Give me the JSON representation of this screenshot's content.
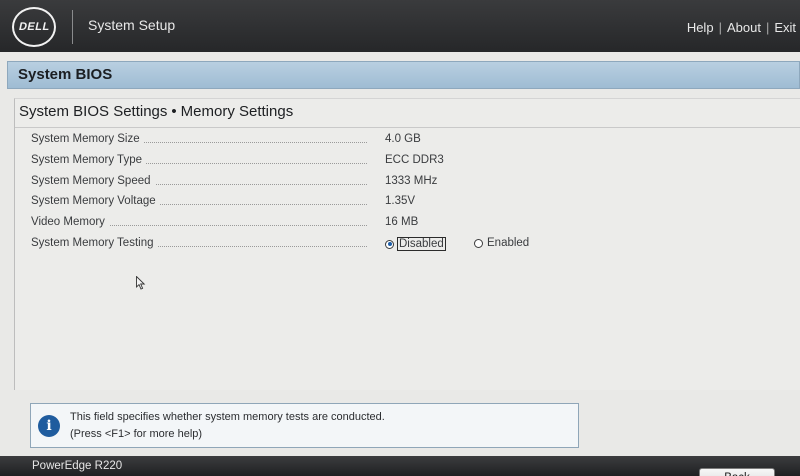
{
  "header": {
    "logo_text": "DELL",
    "app_title": "System Setup",
    "links": [
      "Help",
      "About",
      "Exit"
    ],
    "separator": "|"
  },
  "panel": {
    "title": "System BIOS"
  },
  "breadcrumb": {
    "parent": "System BIOS Settings",
    "separator": "•",
    "current": "Memory Settings"
  },
  "settings": [
    {
      "label": "System Memory Size",
      "value": "4.0 GB"
    },
    {
      "label": "System Memory Type",
      "value": "ECC DDR3"
    },
    {
      "label": "System Memory Speed",
      "value": "1333 MHz"
    },
    {
      "label": "System Memory Voltage",
      "value": "1.35V"
    },
    {
      "label": "Video Memory",
      "value": "16 MB"
    },
    {
      "label": "System Memory Testing",
      "options": [
        "Disabled",
        "Enabled"
      ],
      "selected": "Disabled"
    }
  ],
  "help": {
    "icon": "info-icon",
    "line1": "This field specifies whether system memory tests are conducted.",
    "line2": "(Press <F1> for more help)"
  },
  "footer": {
    "model": "PowerEdge R220",
    "back_label": "Back"
  },
  "colors": {
    "header_bg": "#2a2b2d",
    "panel_bar": "#a9c3d8",
    "content_bg": "#ececea",
    "info_blue": "#1f5c9e"
  }
}
